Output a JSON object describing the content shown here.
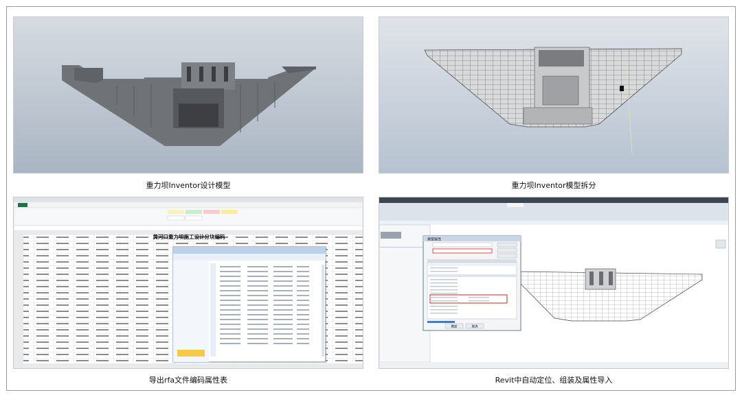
{
  "captions": {
    "top_left": "重力坝Inventor设计模型",
    "top_right": "重力坝Inventor模型拆分",
    "bottom_left": "导出rfa文件编码属性表",
    "bottom_right": "Revit中自动定位、组装及属性导入"
  },
  "excel": {
    "sheet_title": "黄河口重力坝施工设计分块编码"
  },
  "revit": {
    "dialog_title": "类型属性",
    "ok_label": "确定",
    "cancel_label": "取消"
  },
  "colors": {
    "viewport_bg_top": "#d2d8df",
    "viewport_bg_bottom": "#aab7c6",
    "dam_fill": "#6f7276",
    "excel_green": "#1f7244",
    "revit_highlight": "#c62828"
  }
}
